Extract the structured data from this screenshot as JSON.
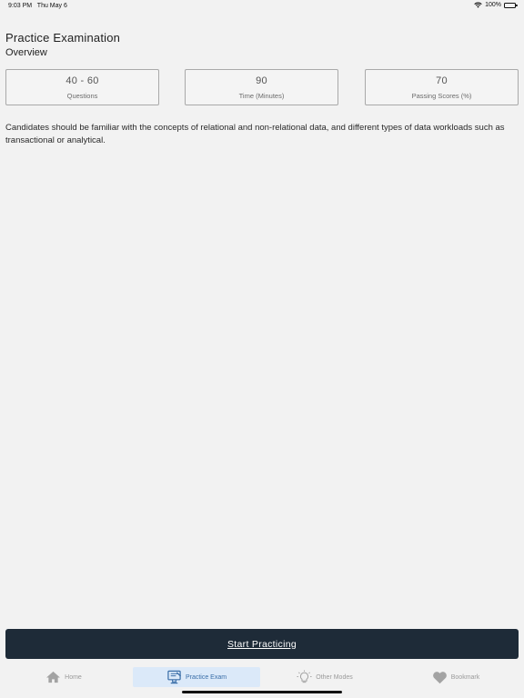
{
  "status_bar": {
    "time": "9:03 PM",
    "date": "Thu May 6",
    "battery": "100%"
  },
  "page": {
    "title": "Practice Examination",
    "subtitle": "Overview"
  },
  "stats": [
    {
      "value": "40 - 60",
      "label": "Questions"
    },
    {
      "value": "90",
      "label": "Time (Minutes)"
    },
    {
      "value": "70",
      "label": "Passing Scores (%)"
    }
  ],
  "description": "Candidates should be familiar with the concepts of relational and non-relational data, and different types of data workloads such as transactional or analytical.",
  "start_button": {
    "label": "Start Practicing"
  },
  "tab_bar": {
    "tabs": [
      {
        "label": "Home",
        "icon": "home-icon",
        "active": false
      },
      {
        "label": "Practice Exam",
        "icon": "practice-exam-icon",
        "active": true
      },
      {
        "label": "Other Modes",
        "icon": "lightbulb-icon",
        "active": false
      },
      {
        "label": "Bookmark",
        "icon": "heart-icon",
        "active": false
      }
    ]
  },
  "colors": {
    "background": "#f2f2f2",
    "button": "#1e2b38",
    "active_tab_bg": "#dbe9f9",
    "active_tab_text": "#3a6ea8",
    "inactive_tab": "#9a9a9a"
  }
}
